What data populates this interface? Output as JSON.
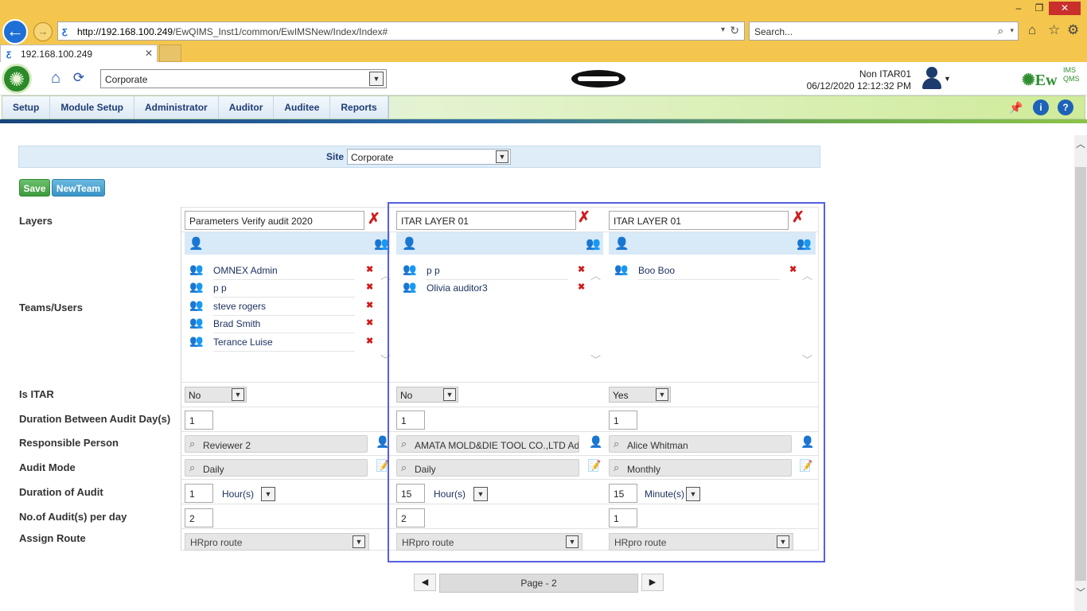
{
  "browser": {
    "url_host": "http://192.168.100.249",
    "url_path": "/EwQIMS_Inst1/common/EwIMSNew/Index/Index#",
    "search_placeholder": "Search...",
    "tab_title": "192.168.100.249"
  },
  "header": {
    "site": "Corporate",
    "user": "Non ITAR01",
    "datetime": "06/12/2020 12:12:32 PM",
    "brand": "EwQIMS"
  },
  "nav": {
    "items": [
      "Setup",
      "Module Setup",
      "Administrator",
      "Auditor",
      "Auditee",
      "Reports"
    ]
  },
  "form": {
    "site_label": "Site",
    "site_value": "Corporate",
    "save_label": "Save",
    "newteam_label": "NewTeam",
    "row_labels": {
      "layers": "Layers",
      "teams": "Teams/Users",
      "itar": "Is ITAR",
      "duration_between": "Duration Between Audit Day(s)",
      "responsible": "Responsible Person",
      "audit_mode": "Audit Mode",
      "duration": "Duration of Audit",
      "audits_per_day": "No.of Audit(s) per day",
      "route": "Assign Route"
    },
    "columns": [
      {
        "layer": "Parameters Verify audit 2020",
        "users": [
          "OMNEX Admin",
          "p p",
          "steve rogers",
          "Brad Smith",
          "Terance Luise"
        ],
        "itar": "No",
        "days": "1",
        "responsible": "Reviewer 2",
        "mode": "Daily",
        "duration": "1",
        "duration_unit": "Hour(s)",
        "per_day": "2",
        "route": "HRpro route"
      },
      {
        "layer": "ITAR LAYER 01",
        "users": [
          "p p",
          "Olivia auditor3"
        ],
        "itar": "No",
        "days": "1",
        "responsible": "AMATA MOLD&DIE TOOL CO.,LTD Admin",
        "mode": "Daily",
        "duration": "15",
        "duration_unit": "Hour(s)",
        "per_day": "2",
        "route": "HRpro route"
      },
      {
        "layer": "ITAR LAYER 01",
        "users": [
          "Boo Boo"
        ],
        "itar": "Yes",
        "days": "1",
        "responsible": "Alice Whitman",
        "mode": "Monthly",
        "duration": "15",
        "duration_unit": "Minute(s)",
        "per_day": "1",
        "route": "HRpro route"
      }
    ]
  },
  "pager": {
    "label": "Page - 2"
  }
}
